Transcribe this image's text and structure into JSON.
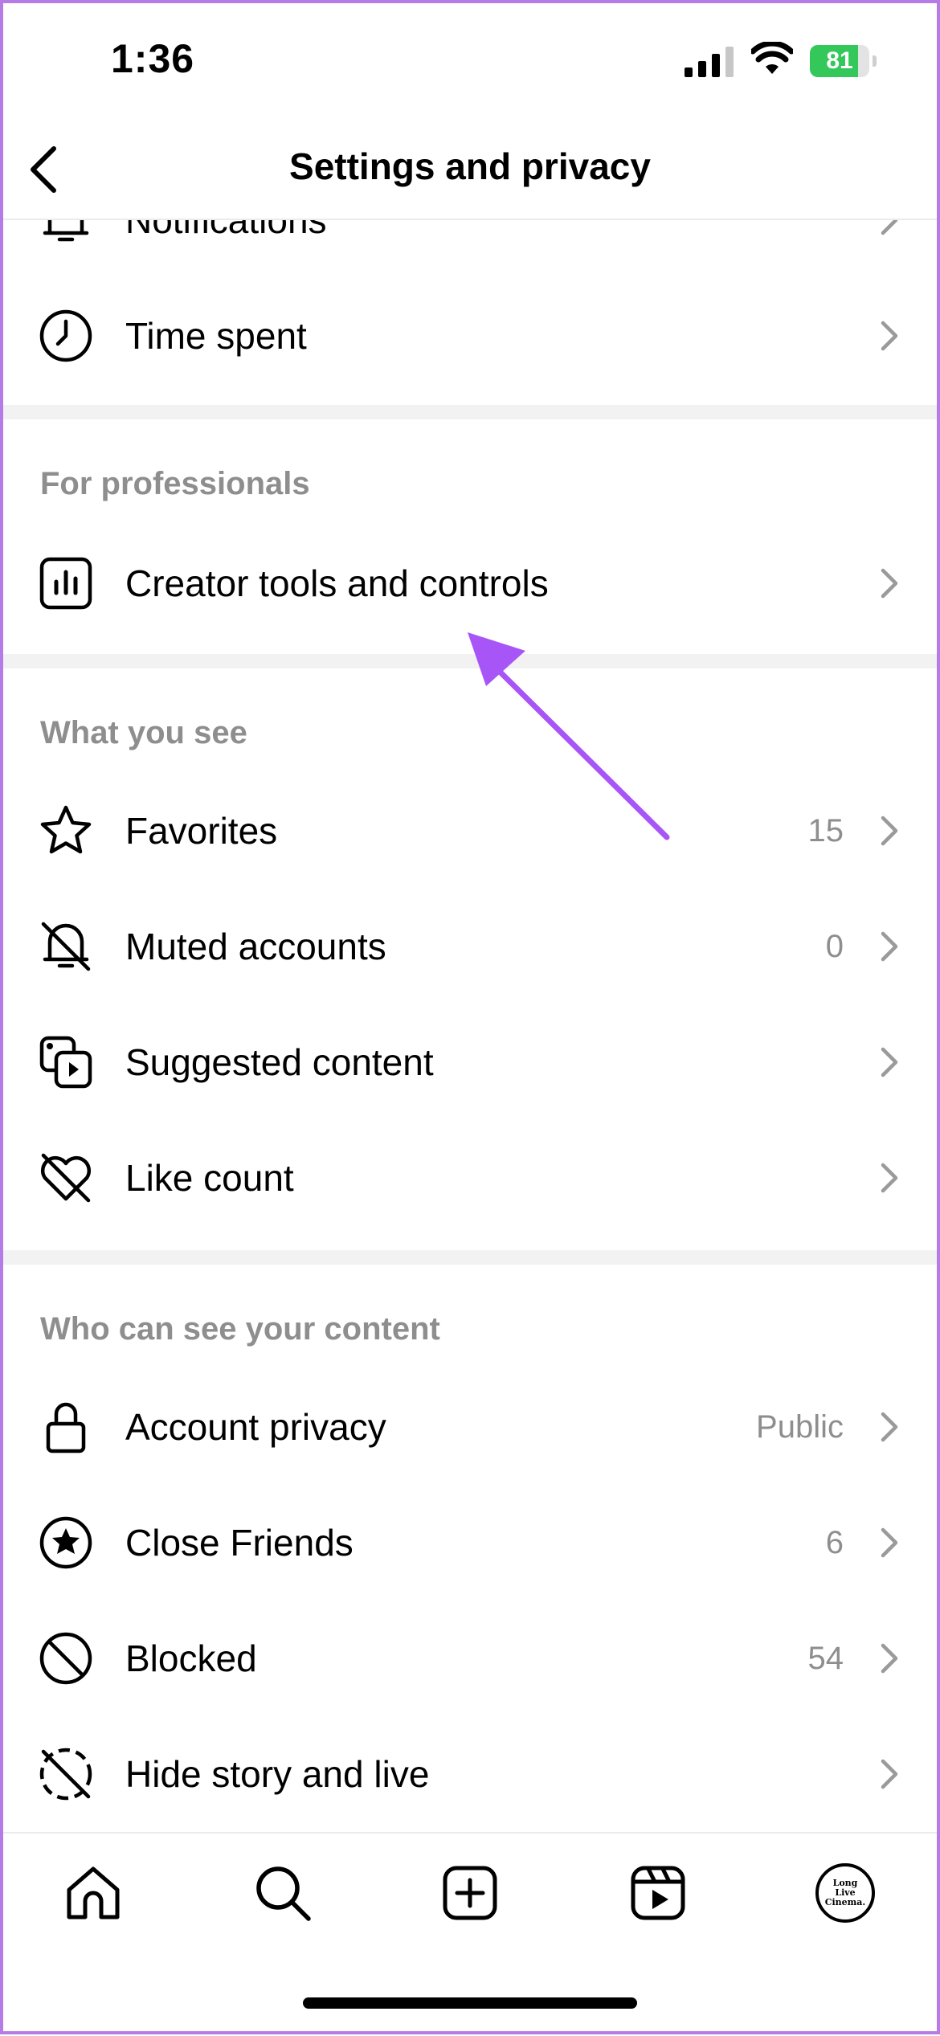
{
  "status_bar": {
    "time": "1:36",
    "battery_text": "81",
    "battery_percent": 81,
    "battery_color": "#34c759"
  },
  "header": {
    "title": "Settings and privacy",
    "back_icon": "chevron-left-icon"
  },
  "sections": [
    {
      "items": [
        {
          "label": "Notifications",
          "icon": "bell-icon",
          "value": ""
        },
        {
          "label": "Time spent",
          "icon": "clock-icon",
          "value": ""
        }
      ]
    },
    {
      "title": "For professionals",
      "items": [
        {
          "label": "Creator tools and controls",
          "icon": "chart-icon",
          "value": ""
        }
      ]
    },
    {
      "title": "What you see",
      "items": [
        {
          "label": "Favorites",
          "icon": "star-icon",
          "value": "15"
        },
        {
          "label": "Muted accounts",
          "icon": "bell-off-icon",
          "value": "0"
        },
        {
          "label": "Suggested content",
          "icon": "media-play-icon",
          "value": ""
        },
        {
          "label": "Like count",
          "icon": "heart-off-icon",
          "value": ""
        }
      ]
    },
    {
      "title": "Who can see your content",
      "items": [
        {
          "label": "Account privacy",
          "icon": "lock-icon",
          "value": "Public"
        },
        {
          "label": "Close Friends",
          "icon": "star-circle-icon",
          "value": "6"
        },
        {
          "label": "Blocked",
          "icon": "blocked-icon",
          "value": "54"
        },
        {
          "label": "Hide story and live",
          "icon": "story-off-icon",
          "value": ""
        }
      ]
    }
  ],
  "tabbar": {
    "items": [
      "home-icon",
      "search-icon",
      "create-icon",
      "reels-icon",
      "profile-avatar"
    ],
    "avatar_text": [
      "Long",
      "Live",
      "Cinema."
    ]
  },
  "annotation": {
    "arrow_color": "#a855f7"
  }
}
